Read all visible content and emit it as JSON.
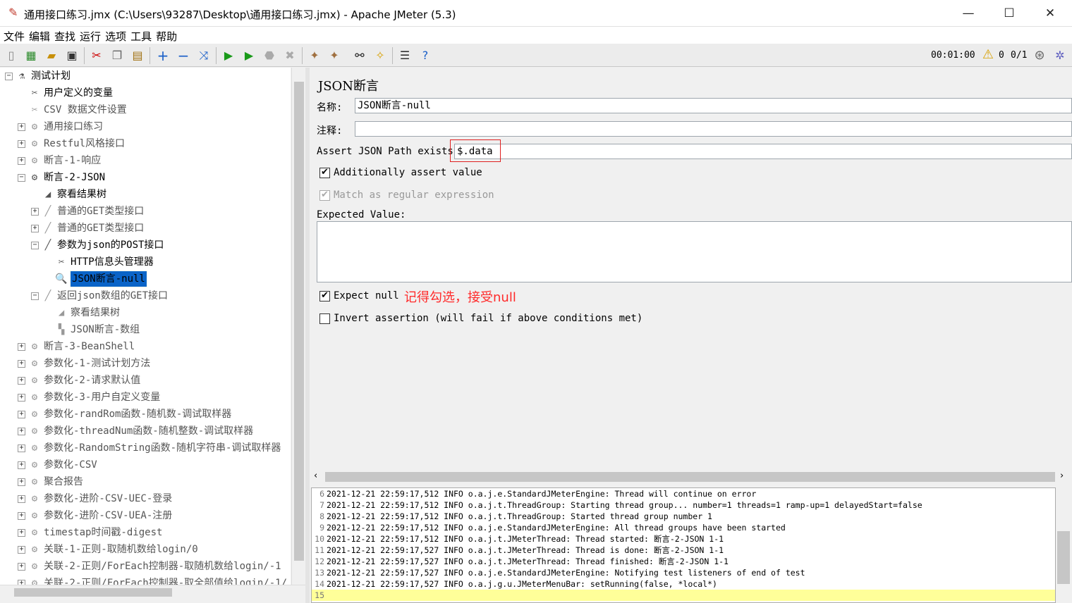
{
  "window": {
    "title": "通用接口练习.jmx (C:\\Users\\93287\\Desktop\\通用接口练习.jmx) - Apache JMeter (5.3)"
  },
  "menu": [
    "文件",
    "编辑",
    "查找",
    "运行",
    "选项",
    "工具",
    "帮助"
  ],
  "status": {
    "timer": "00:01:00",
    "warnings": "0",
    "threads": "0/1"
  },
  "tree": [
    {
      "label": "测试计划",
      "icon": "flask-icon",
      "glyph": "⚗",
      "enabled": true,
      "level": 0,
      "exp": "-"
    },
    {
      "label": "用户定义的变量",
      "icon": "wrench-icon",
      "glyph": "✂",
      "enabled": true,
      "level": 1,
      "exp": ""
    },
    {
      "label": "CSV 数据文件设置",
      "icon": "wrench-icon",
      "glyph": "✂",
      "enabled": false,
      "level": 1,
      "exp": ""
    },
    {
      "label": "通用接口练习",
      "icon": "gear-icon",
      "glyph": "⚙",
      "enabled": false,
      "level": 1,
      "exp": "+"
    },
    {
      "label": "Restful风格接口",
      "icon": "gear-icon",
      "glyph": "⚙",
      "enabled": false,
      "level": 1,
      "exp": "+"
    },
    {
      "label": "断言-1-响应",
      "icon": "gear-icon",
      "glyph": "⚙",
      "enabled": false,
      "level": 1,
      "exp": "+"
    },
    {
      "label": "断言-2-JSON",
      "icon": "gear-icon",
      "glyph": "⚙",
      "enabled": true,
      "level": 1,
      "exp": "-"
    },
    {
      "label": "察看结果树",
      "icon": "chart-icon",
      "glyph": "◢",
      "enabled": true,
      "level": 2,
      "exp": ""
    },
    {
      "label": "普通的GET类型接口",
      "icon": "pipette-icon",
      "glyph": "╱",
      "enabled": false,
      "level": 2,
      "exp": "+"
    },
    {
      "label": "普通的GET类型接口",
      "icon": "pipette-icon",
      "glyph": "╱",
      "enabled": false,
      "level": 2,
      "exp": "+"
    },
    {
      "label": "参数为json的POST接口",
      "icon": "pipette-icon",
      "glyph": "╱",
      "enabled": true,
      "level": 2,
      "exp": "-"
    },
    {
      "label": "HTTP信息头管理器",
      "icon": "wrench-icon",
      "glyph": "✂",
      "enabled": true,
      "level": 3,
      "exp": ""
    },
    {
      "label": "JSON断言-null",
      "icon": "magnifier-icon",
      "glyph": "🔍",
      "enabled": true,
      "level": 3,
      "exp": "",
      "selected": true
    },
    {
      "label": "返回json数组的GET接口",
      "icon": "pipette-icon",
      "glyph": "╱",
      "enabled": false,
      "level": 2,
      "exp": "-"
    },
    {
      "label": "察看结果树",
      "icon": "chart-icon",
      "glyph": "◢",
      "enabled": false,
      "level": 3,
      "exp": ""
    },
    {
      "label": "JSON断言-数组",
      "icon": "assertion-icon",
      "glyph": "▚",
      "enabled": false,
      "level": 3,
      "exp": ""
    },
    {
      "label": "断言-3-BeanShell",
      "icon": "gear-icon",
      "glyph": "⚙",
      "enabled": false,
      "level": 1,
      "exp": "+"
    },
    {
      "label": "参数化-1-测试计划方法",
      "icon": "gear-icon",
      "glyph": "⚙",
      "enabled": false,
      "level": 1,
      "exp": "+"
    },
    {
      "label": "参数化-2-请求默认值",
      "icon": "gear-icon",
      "glyph": "⚙",
      "enabled": false,
      "level": 1,
      "exp": "+"
    },
    {
      "label": "参数化-3-用户自定义变量",
      "icon": "gear-icon",
      "glyph": "⚙",
      "enabled": false,
      "level": 1,
      "exp": "+"
    },
    {
      "label": "参数化-randRom函数-随机数-调试取样器",
      "icon": "gear-icon",
      "glyph": "⚙",
      "enabled": false,
      "level": 1,
      "exp": "+"
    },
    {
      "label": "参数化-threadNum函数-随机整数-调试取样器",
      "icon": "gear-icon",
      "glyph": "⚙",
      "enabled": false,
      "level": 1,
      "exp": "+"
    },
    {
      "label": "参数化-RandomString函数-随机字符串-调试取样器",
      "icon": "gear-icon",
      "glyph": "⚙",
      "enabled": false,
      "level": 1,
      "exp": "+"
    },
    {
      "label": "参数化-CSV",
      "icon": "gear-icon",
      "glyph": "⚙",
      "enabled": false,
      "level": 1,
      "exp": "+"
    },
    {
      "label": "聚合报告",
      "icon": "gear-icon",
      "glyph": "⚙",
      "enabled": false,
      "level": 1,
      "exp": "+"
    },
    {
      "label": "参数化-进阶-CSV-UEC-登录",
      "icon": "gear-icon",
      "glyph": "⚙",
      "enabled": false,
      "level": 1,
      "exp": "+"
    },
    {
      "label": "参数化-进阶-CSV-UEA-注册",
      "icon": "gear-icon",
      "glyph": "⚙",
      "enabled": false,
      "level": 1,
      "exp": "+"
    },
    {
      "label": "timestap时间戳-digest",
      "icon": "gear-icon",
      "glyph": "⚙",
      "enabled": false,
      "level": 1,
      "exp": "+"
    },
    {
      "label": "关联-1-正则-取随机数给login/0",
      "icon": "gear-icon",
      "glyph": "⚙",
      "enabled": false,
      "level": 1,
      "exp": "+"
    },
    {
      "label": "关联-2-正则/ForEach控制器-取随机数给login/-1",
      "icon": "gear-icon",
      "glyph": "⚙",
      "enabled": false,
      "level": 1,
      "exp": "+"
    },
    {
      "label": "关联-2-正则/ForEach控制器-取全部值给login/-1/",
      "icon": "gear-icon",
      "glyph": "⚙",
      "enabled": false,
      "level": 1,
      "exp": "+"
    }
  ],
  "panel": {
    "title": "JSON断言",
    "name_label": "名称:",
    "name_value": "JSON断言-null",
    "comment_label": "注释:",
    "comment_value": "",
    "path_label": "Assert JSON Path exists:",
    "path_value": "$.data",
    "cb_additional": "Additionally assert value",
    "cb_regex": "Match as regular expression",
    "expected_label": "Expected Value:",
    "expected_value": "",
    "cb_expect_null": "Expect null",
    "annotation": "记得勾选，接受null",
    "cb_invert": "Invert assertion (will fail if above conditions met)"
  },
  "log": [
    {
      "n": "6",
      "t": "2021-12-21 22:59:17,512 INFO o.a.j.e.StandardJMeterEngine: Thread will continue on error"
    },
    {
      "n": "7",
      "t": "2021-12-21 22:59:17,512 INFO o.a.j.t.ThreadGroup: Starting thread group... number=1 threads=1 ramp-up=1 delayedStart=false"
    },
    {
      "n": "8",
      "t": "2021-12-21 22:59:17,512 INFO o.a.j.t.ThreadGroup: Started thread group number 1"
    },
    {
      "n": "9",
      "t": "2021-12-21 22:59:17,512 INFO o.a.j.e.StandardJMeterEngine: All thread groups have been started"
    },
    {
      "n": "10",
      "t": "2021-12-21 22:59:17,512 INFO o.a.j.t.JMeterThread: Thread started: 断言-2-JSON 1-1"
    },
    {
      "n": "11",
      "t": "2021-12-21 22:59:17,527 INFO o.a.j.t.JMeterThread: Thread is done: 断言-2-JSON 1-1"
    },
    {
      "n": "12",
      "t": "2021-12-21 22:59:17,527 INFO o.a.j.t.JMeterThread: Thread finished: 断言-2-JSON 1-1"
    },
    {
      "n": "13",
      "t": "2021-12-21 22:59:17,527 INFO o.a.j.e.StandardJMeterEngine: Notifying test listeners of end of test"
    },
    {
      "n": "14",
      "t": "2021-12-21 22:59:17,527 INFO o.a.j.g.u.JMeterMenuBar: setRunning(false, *local*)"
    },
    {
      "n": "15",
      "t": ""
    }
  ]
}
